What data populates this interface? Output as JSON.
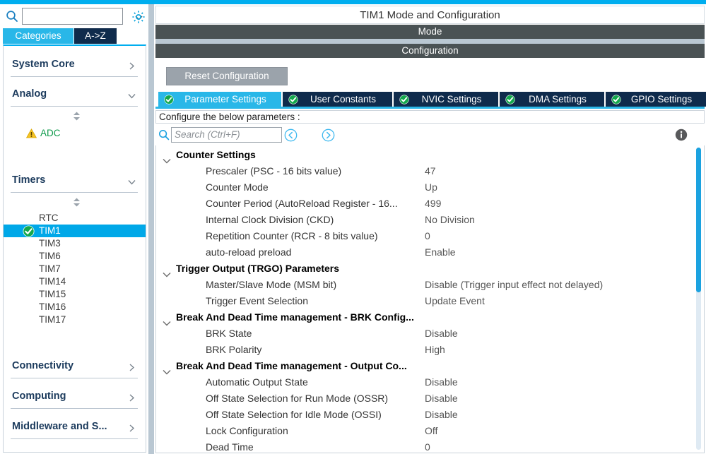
{
  "sidebar": {
    "search": {
      "value": "",
      "placeholder": ""
    },
    "gear_icon": "gear-icon",
    "tabs": [
      {
        "id": "categories",
        "label": "Categories",
        "active": true
      },
      {
        "id": "a-to-z",
        "label": "A->Z",
        "active": false
      }
    ],
    "groups": [
      {
        "id": "system-core",
        "label": "System Core",
        "expanded": false,
        "chevron": "chevron-right-icon"
      },
      {
        "id": "analog",
        "label": "Analog",
        "expanded": true,
        "chevron": "chevron-down-icon"
      },
      {
        "id": "timers",
        "label": "Timers",
        "expanded": true,
        "chevron": "chevron-down-icon"
      },
      {
        "id": "connectivity",
        "label": "Connectivity",
        "expanded": false,
        "chevron": "chevron-right-icon"
      },
      {
        "id": "computing",
        "label": "Computing",
        "expanded": false,
        "chevron": "chevron-right-icon"
      },
      {
        "id": "middleware",
        "label": "Middleware and S...",
        "expanded": false,
        "chevron": "chevron-right-icon"
      }
    ],
    "analog_items": [
      {
        "label": "ADC",
        "state": "warning",
        "icon": "warning-triangle-icon",
        "selected": false
      }
    ],
    "timer_items": [
      {
        "label": "RTC",
        "state": "none",
        "selected": false
      },
      {
        "label": "TIM1",
        "state": "configured",
        "icon": "check-circle-icon",
        "selected": true
      },
      {
        "label": "TIM3",
        "state": "none",
        "selected": false
      },
      {
        "label": "TIM6",
        "state": "none",
        "selected": false
      },
      {
        "label": "TIM7",
        "state": "none",
        "selected": false
      },
      {
        "label": "TIM14",
        "state": "none",
        "selected": false
      },
      {
        "label": "TIM15",
        "state": "none",
        "selected": false
      },
      {
        "label": "TIM16",
        "state": "none",
        "selected": false
      },
      {
        "label": "TIM17",
        "state": "none",
        "selected": false
      }
    ]
  },
  "main": {
    "panel_title": "TIM1 Mode and Configuration",
    "mode_bar": "Mode",
    "configuration_bar": "Configuration",
    "reset_button": "Reset Configuration",
    "tabs": [
      {
        "id": "parameter-settings",
        "label": "Parameter Settings",
        "active": true,
        "icon": "check-circle-icon"
      },
      {
        "id": "user-constants",
        "label": "User Constants",
        "active": false,
        "icon": "check-circle-icon"
      },
      {
        "id": "nvic-settings",
        "label": "NVIC Settings",
        "active": false,
        "icon": "check-circle-icon"
      },
      {
        "id": "dma-settings",
        "label": "DMA Settings",
        "active": false,
        "icon": "check-circle-icon"
      },
      {
        "id": "gpio-settings",
        "label": "GPIO Settings",
        "active": false,
        "icon": "check-circle-icon"
      }
    ],
    "configure_label": "Configure the below parameters :",
    "search": {
      "value": "",
      "placeholder": "Search (Ctrl+F)"
    },
    "nav_prev_icon": "chevron-left-circle-icon",
    "nav_next_icon": "chevron-right-circle-icon",
    "info_icon": "info-icon",
    "tree": [
      {
        "type": "group",
        "label": "Counter Settings",
        "expanded": true
      },
      {
        "type": "item",
        "label": "Prescaler (PSC - 16 bits value)",
        "value": "47"
      },
      {
        "type": "item",
        "label": "Counter Mode",
        "value": "Up"
      },
      {
        "type": "item",
        "label": "Counter Period (AutoReload Register - 16...",
        "value": "499"
      },
      {
        "type": "item",
        "label": "Internal Clock Division (CKD)",
        "value": "No Division"
      },
      {
        "type": "item",
        "label": "Repetition Counter (RCR - 8 bits value)",
        "value": "0"
      },
      {
        "type": "item",
        "label": "auto-reload preload",
        "value": "Enable"
      },
      {
        "type": "group",
        "label": "Trigger Output (TRGO) Parameters",
        "expanded": true
      },
      {
        "type": "item",
        "label": "Master/Slave Mode (MSM bit)",
        "value": "Disable (Trigger input effect not delayed)"
      },
      {
        "type": "item",
        "label": "Trigger Event Selection",
        "value": "Update Event"
      },
      {
        "type": "group",
        "label": "Break And Dead Time management - BRK Config...",
        "expanded": true
      },
      {
        "type": "item",
        "label": "BRK State",
        "value": "Disable"
      },
      {
        "type": "item",
        "label": "BRK Polarity",
        "value": "High"
      },
      {
        "type": "group",
        "label": "Break And Dead Time management - Output Co...",
        "expanded": true
      },
      {
        "type": "item",
        "label": "Automatic Output State",
        "value": "Disable"
      },
      {
        "type": "item",
        "label": "Off State Selection for Run Mode (OSSR)",
        "value": "Disable"
      },
      {
        "type": "item",
        "label": "Off State Selection for Idle Mode (OSSI)",
        "value": "Disable"
      },
      {
        "type": "item",
        "label": "Lock Configuration",
        "value": "Off"
      },
      {
        "type": "item",
        "label": "Dead Time",
        "value": "0"
      }
    ]
  },
  "colors": {
    "accent_cyan": "#00aeef",
    "tab_active": "#29b7e8",
    "tab_inactive": "#0f2b4c",
    "bar_dark": "#4a5254",
    "selection": "#00a8e8",
    "warning": "#f5c518",
    "ok_green": "#0d9a4a"
  }
}
